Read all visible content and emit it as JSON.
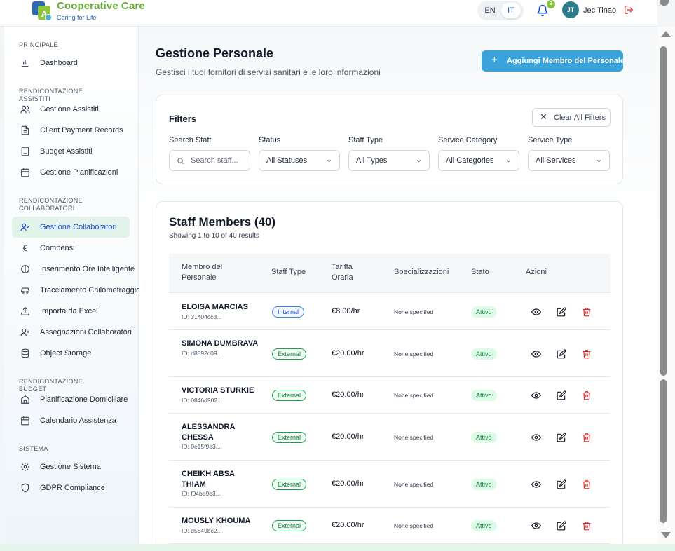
{
  "header": {
    "brand_title": "Cooperative Care",
    "brand_sub": "Caring for Life",
    "logo_letter": "A",
    "lang_en": "EN",
    "lang_it": "IT",
    "notifications_count": "3",
    "avatar_initials": "JT",
    "username": "Jec Tinao"
  },
  "sidebar": {
    "sections": [
      {
        "title": "PRINCIPALE",
        "items": [
          {
            "label": "Dashboard",
            "icon": "bar-chart-icon"
          }
        ]
      },
      {
        "title": "RENDICONTAZIONE ASSISTITI",
        "items": [
          {
            "label": "Gestione Assistiti",
            "icon": "users-icon"
          },
          {
            "label": "Client Payment Records",
            "icon": "file-text-icon"
          },
          {
            "label": "Budget Assistiti",
            "icon": "calculator-icon"
          },
          {
            "label": "Gestione Pianificazioni",
            "icon": "calendar-icon"
          }
        ]
      },
      {
        "title": "RENDICONTAZIONE COLLABORATORI",
        "items": [
          {
            "label": "Gestione Collaboratori",
            "icon": "user-check-icon",
            "active": true
          },
          {
            "label": "Compensi",
            "icon": "euro-icon"
          },
          {
            "label": "Inserimento Ore Intelligente",
            "icon": "clock-icon"
          },
          {
            "label": "Tracciamento Chilometraggio",
            "icon": "car-icon"
          },
          {
            "label": "Importa da Excel",
            "icon": "upload-icon"
          },
          {
            "label": "Assegnazioni Collaboratori",
            "icon": "user-plus-icon"
          },
          {
            "label": "Object Storage",
            "icon": "database-icon"
          }
        ]
      },
      {
        "title": "RENDICONTAZIONE BUDGET",
        "items": [
          {
            "label": "Pianificazione Domiciliare",
            "icon": "home-icon"
          },
          {
            "label": "Calendario Assistenza",
            "icon": "calendar-icon"
          }
        ]
      },
      {
        "title": "SISTEMA",
        "items": [
          {
            "label": "Gestione Sistema",
            "icon": "gear-icon"
          },
          {
            "label": "GDPR Compliance",
            "icon": "shield-icon"
          }
        ]
      }
    ]
  },
  "page": {
    "title": "Gestione Personale",
    "subtitle": "Gestisci i tuoi fornitori di servizi sanitari e le loro informazioni",
    "add_button": "Aggiungi Membro del Personale"
  },
  "filters": {
    "title": "Filters",
    "clear_label": "Clear All Filters",
    "search_label": "Search Staff",
    "search_placeholder": "Search staff...",
    "status_label": "Status",
    "status_value": "All Statuses",
    "type_label": "Staff Type",
    "type_value": "All Types",
    "category_label": "Service Category",
    "category_value": "All Categories",
    "service_label": "Service Type",
    "service_value": "All Services"
  },
  "staff": {
    "title": "Staff Members (40)",
    "showing": "Showing 1 to 10 of 40 results",
    "columns": [
      "Membro del Personale",
      "Staff Type",
      "Tariffa Oraria",
      "Specializzazioni",
      "Stato",
      "Azioni"
    ],
    "rows": [
      {
        "name": "ELOISA MARCIAS",
        "id": "ID: 31404ccd...",
        "type": "Internal",
        "rate": "€8.00/hr",
        "spec": "None specified",
        "status": "Attivo"
      },
      {
        "name": "SIMONA DUMBRAVA",
        "id": "ID: d8892c09...",
        "type": "External",
        "rate": "€20.00/hr",
        "spec": "None specified",
        "status": "Attivo"
      },
      {
        "name": "VICTORIA STURKIE",
        "id": "ID: 0846d902...",
        "type": "External",
        "rate": "€20.00/hr",
        "spec": "None specified",
        "status": "Attivo"
      },
      {
        "name": "ALESSANDRA CHESSA",
        "id": "ID: 0e15f9e3...",
        "type": "External",
        "rate": "€20.00/hr",
        "spec": "None specified",
        "status": "Attivo"
      },
      {
        "name": "CHEIKH ABSA THIAM",
        "id": "ID: f94ba9b3...",
        "type": "External",
        "rate": "€20.00/hr",
        "spec": "None specified",
        "status": "Attivo"
      },
      {
        "name": "MOUSLY KHOUMA",
        "id": "ID: d5649bc2...",
        "type": "External",
        "rate": "€20.00/hr",
        "spec": "None specified",
        "status": "Attivo"
      }
    ]
  },
  "colors": {
    "accent": "#3aa3dc",
    "brand_green": "#6aaa3a",
    "brand_blue": "#2d6cb5",
    "delete_red": "#dc2626",
    "active_bg": "#e2f4e9"
  }
}
